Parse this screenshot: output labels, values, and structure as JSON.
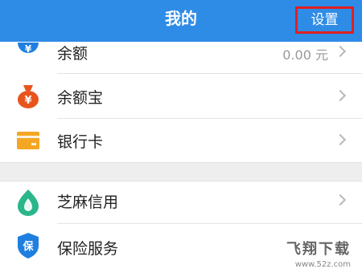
{
  "header": {
    "title": "我的",
    "settings_label": "设置"
  },
  "account_items": [
    {
      "label": "余额",
      "value": "0.00 元",
      "icon": "yuan-icon",
      "color": "#1E7FE0"
    },
    {
      "label": "余额宝",
      "icon": "money-bag-icon",
      "color": "#E8541E"
    },
    {
      "label": "银行卡",
      "icon": "bank-card-icon",
      "color": "#F5A623"
    }
  ],
  "service_items": [
    {
      "label": "芝麻信用",
      "icon": "sesame-credit-icon",
      "color": "#2BB58B"
    },
    {
      "label": "保险服务",
      "icon": "insurance-shield-icon",
      "color": "#1E7FE0"
    }
  ],
  "watermark": {
    "brand": "飞翔下载",
    "url": "www.52z.com"
  }
}
